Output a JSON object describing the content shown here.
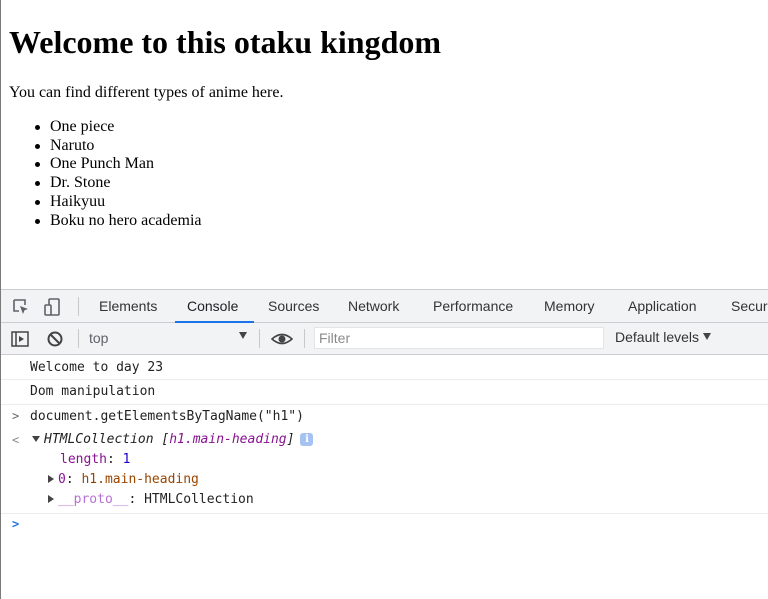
{
  "page": {
    "heading": "Welcome to this otaku kingdom",
    "paragraph": "You can find different types of anime here.",
    "anime_list": [
      "One piece",
      "Naruto",
      "One Punch Man",
      "Dr. Stone",
      "Haikyuu",
      "Boku no hero academia"
    ]
  },
  "devtools": {
    "tabs": [
      "Elements",
      "Console",
      "Sources",
      "Network",
      "Performance",
      "Memory",
      "Application",
      "Secur"
    ],
    "active_tab": "Console",
    "toolbar": {
      "context": "top",
      "filter_placeholder": "Filter",
      "levels": "Default levels"
    },
    "console": {
      "logs": [
        "Welcome to day 23",
        "Dom manipulation"
      ],
      "input_command": "document.getElementsByTagName(\"h1\")",
      "input_prompt": ">",
      "output_back_arrow": "<",
      "result": {
        "type": "HTMLCollection",
        "summary_element": "h1.main-heading",
        "length_key": "length",
        "length_value": "1",
        "item_index": "0",
        "item_value": "h1.main-heading",
        "proto_key": "__proto__",
        "proto_value": "HTMLCollection"
      },
      "prompt_caret": ">"
    },
    "colors": {
      "accent": "#1a73e8",
      "toolbar_bg": "#f1f3f4"
    }
  }
}
